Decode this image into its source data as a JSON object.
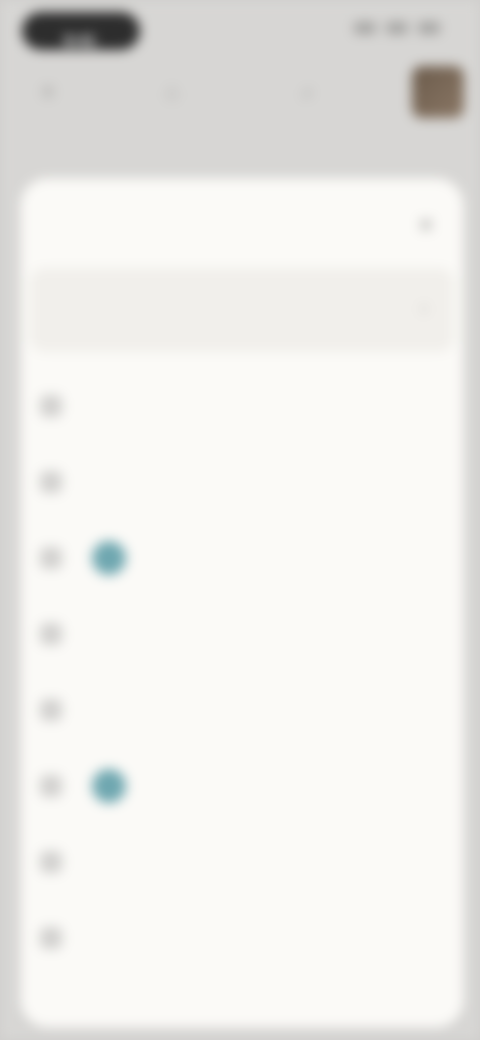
{
  "status_bar": {
    "time": "9:41",
    "icons": [
      "signal-icon",
      "wifi-icon",
      "battery-icon"
    ]
  },
  "app_bar": {
    "menu_icon": "menu-icon",
    "home_icon": "home-icon",
    "search_icon": "search-icon",
    "avatar": "avatar"
  },
  "panel": {
    "title": "",
    "close_icon": "close-icon",
    "account": {
      "name": "",
      "email": "",
      "chevron_icon": "chevron-right-icon"
    },
    "menu": [
      {
        "label": "",
        "dot": false
      },
      {
        "label": "",
        "dot": false
      },
      {
        "label": "",
        "dot": true
      },
      {
        "label": "",
        "dot": false
      },
      {
        "label": "",
        "dot": false
      },
      {
        "label": "",
        "dot": true
      },
      {
        "label": "",
        "dot": false
      },
      {
        "label": "",
        "dot": false
      }
    ]
  },
  "colors": {
    "accent_dot": "#6fa7b0",
    "panel_bg": "#fbfaf7",
    "screen_bg": "#d7d6d4"
  }
}
